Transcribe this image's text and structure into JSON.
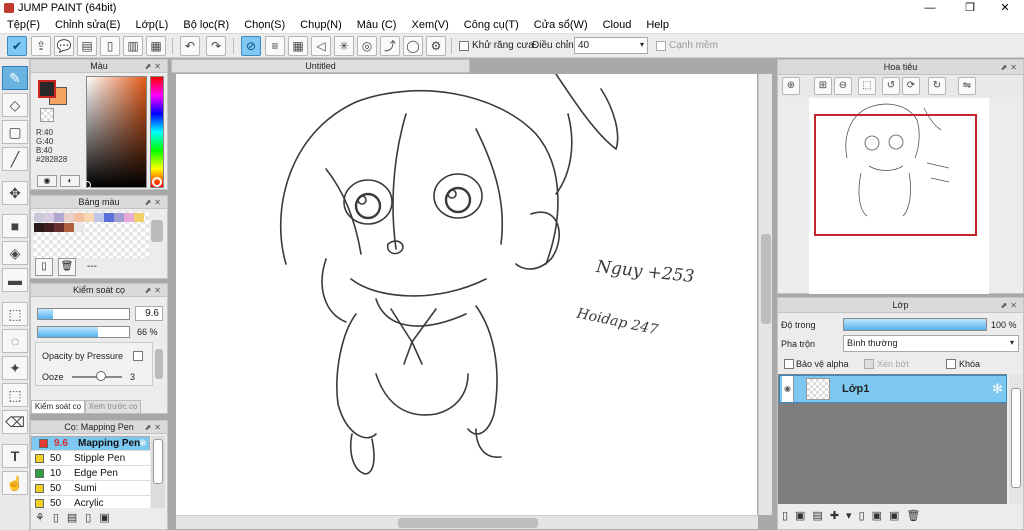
{
  "app": {
    "title": "JUMP PAINT (64bit)",
    "window_buttons": [
      "—",
      "❐",
      "✕"
    ]
  },
  "menu": [
    "Tệp(F)",
    "Chỉnh sửa(E)",
    "Lớp(L)",
    "Bộ lọc(R)",
    "Chọn(S)",
    "Chụp(N)",
    "Màu (C)",
    "Xem(V)",
    "Công cụ(T)",
    "Cửa sổ(W)",
    "Cloud",
    "Help"
  ],
  "toolbar": {
    "antialias_label": "Khử răng cưa",
    "adjust_label": "Điều chỉnh",
    "adjust_value": "40",
    "edge_label": "Cạnh mềm"
  },
  "color_panel": {
    "title": "Màu",
    "r": "R:40",
    "g": "G:40",
    "b": "B:40",
    "hex": "#282828",
    "fg_color": "#282828",
    "bg_color": "#f4a460"
  },
  "palette_panel": {
    "title": "Bảng màu",
    "dash": "---",
    "swatches": [
      "#c8c8d8",
      "#d8c8e0",
      "#b0a8d0",
      "#e8d0c8",
      "#f0c0a0",
      "#f8d8b0",
      "#c0c8e8",
      "#5870d8",
      "#a0a0d0",
      "#e8a8d8",
      "#f0d068",
      "#2a1a1a",
      "#402020",
      "#683030",
      "#b06040",
      "#e8e8e8"
    ]
  },
  "brush_control": {
    "title": "Kiểm soát cọ",
    "size_value": "9.6",
    "size_fill": 0.16,
    "opacity_value": "66 %",
    "opacity_fill": 0.66,
    "pressure_label": "Opacity by Pressure",
    "ooze_label": "Ooze",
    "ooze_value": "3",
    "tab1": "Kiểm soát cọ",
    "tab2": "Xem trước cọ"
  },
  "brush_list": {
    "title": "Cọ: Mapping Pen",
    "items": [
      {
        "size": "9.6",
        "name": "Mapping Pen",
        "color": "#e53935"
      },
      {
        "size": "50",
        "name": "Stipple Pen",
        "color": "#f2d024"
      },
      {
        "size": "10",
        "name": "Edge Pen",
        "color": "#2ea043"
      },
      {
        "size": "50",
        "name": "Sumi",
        "color": "#f2d024"
      },
      {
        "size": "50",
        "name": "Acrylic",
        "color": "#f2d024"
      }
    ]
  },
  "canvas": {
    "tab_title": "Untitled",
    "sig1": "Nguy +253",
    "sig2": "Hoidap 247"
  },
  "navigator": {
    "title": "Hoa tiêu"
  },
  "layers": {
    "title": "Lớp",
    "opacity_label": "Độ trong",
    "opacity_value": "100 %",
    "opacity_fill": 1.0,
    "blend_label": "Pha trộn",
    "blend_value": "Bình thường",
    "protect_alpha": "Bảo vệ alpha",
    "clipping": "Xén bớt",
    "lock": "Khóa",
    "layer_name": "Lớp1"
  }
}
